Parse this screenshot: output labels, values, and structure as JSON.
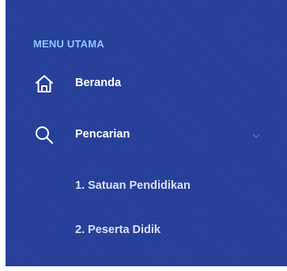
{
  "sidebar": {
    "section_title": "MENU UTAMA",
    "items": [
      {
        "label": "Beranda",
        "icon": "home-icon"
      },
      {
        "label": "Pencarian",
        "icon": "search-icon",
        "expanded": true,
        "chevron": "chevron-down-icon"
      }
    ],
    "subitems": [
      {
        "label": "1. Satuan Pendidikan"
      },
      {
        "label": "2. Peserta Didik"
      }
    ]
  },
  "colors": {
    "background": "#26409a",
    "section_title": "#8fc5ff",
    "text": "#ffffff",
    "subtext": "#d6e0f5"
  }
}
